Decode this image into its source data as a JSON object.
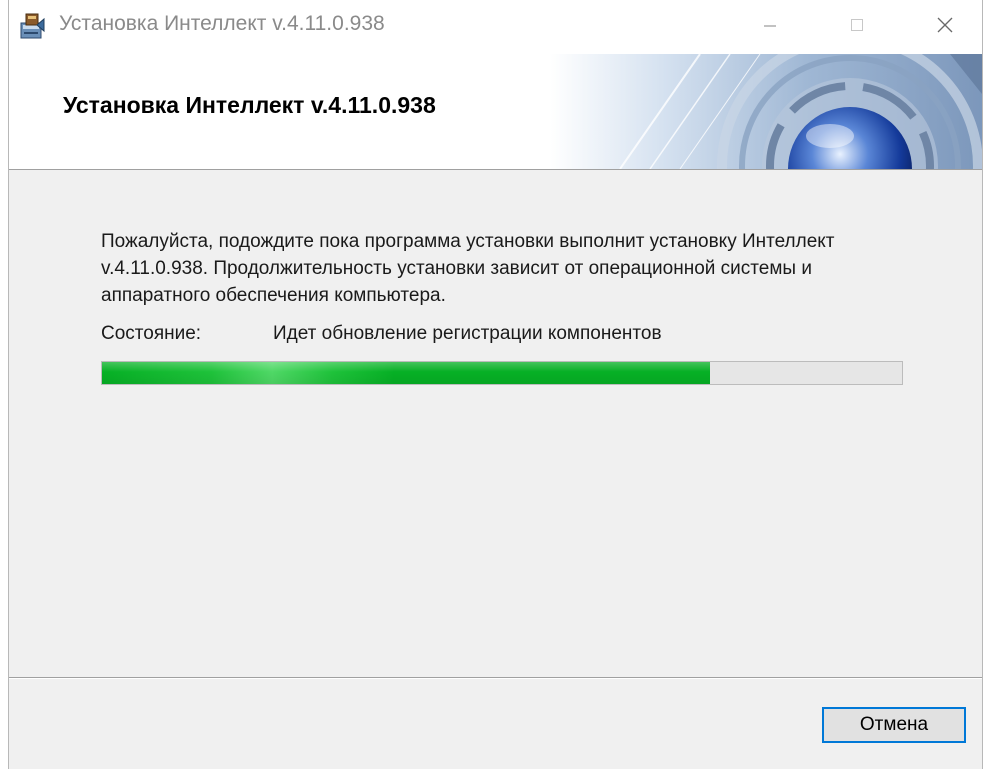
{
  "window": {
    "title": "Установка Интеллект v.4.11.0.938",
    "app_icon": "installer-icon",
    "controls": [
      "minimize-icon",
      "maximize-icon",
      "close-icon"
    ]
  },
  "banner": {
    "title": "Установка Интеллект v.4.11.0.938"
  },
  "content": {
    "description": "Пожалуйста, подождите пока программа установки выполнит установку Интеллект v.4.11.0.938. Продолжительность установки зависит от операционной системы и аппаратного обеспечения компьютера.",
    "status_label": "Состояние:",
    "status_value": "Идет обновление регистрации компонентов",
    "progress_fraction": 0.76,
    "progress_color": "#06b025"
  },
  "footer": {
    "cancel_label": "Отмена"
  },
  "colors": {
    "accent": "#0078d7",
    "window_bg": "#f0f0f0"
  }
}
